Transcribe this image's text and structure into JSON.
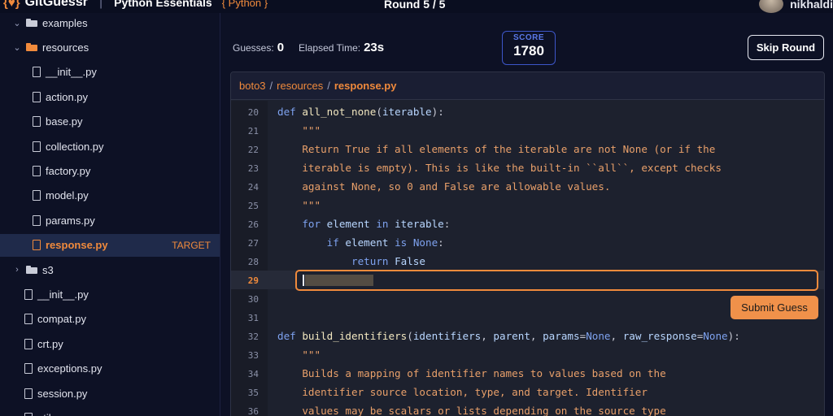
{
  "header": {
    "app_name": "GitGuessr",
    "repo": "Python Essentials",
    "language": "{ Python }",
    "round": "Round 5 / 5",
    "username": "nikhaldi"
  },
  "stats": {
    "guesses_label": "Guesses:",
    "guesses": "0",
    "elapsed_label": "Elapsed Time:",
    "elapsed": "23s",
    "score_label": "SCORE",
    "score": "1780",
    "skip_label": "Skip Round"
  },
  "sidebar": {
    "items": [
      {
        "label": "examples",
        "kind": "folder",
        "color": "gray",
        "chevron": "v"
      },
      {
        "label": "resources",
        "kind": "folder",
        "color": "orange",
        "chevron": "v"
      },
      {
        "label": "__init__.py",
        "kind": "file"
      },
      {
        "label": "action.py",
        "kind": "file"
      },
      {
        "label": "base.py",
        "kind": "file"
      },
      {
        "label": "collection.py",
        "kind": "file"
      },
      {
        "label": "factory.py",
        "kind": "file"
      },
      {
        "label": "model.py",
        "kind": "file"
      },
      {
        "label": "params.py",
        "kind": "file"
      },
      {
        "label": "response.py",
        "kind": "file",
        "active": true,
        "tag": "TARGET"
      },
      {
        "label": "s3",
        "kind": "folder",
        "color": "gray",
        "chevron": ">"
      },
      {
        "label": "__init__.py",
        "kind": "file"
      },
      {
        "label": "compat.py",
        "kind": "file"
      },
      {
        "label": "crt.py",
        "kind": "file"
      },
      {
        "label": "exceptions.py",
        "kind": "file"
      },
      {
        "label": "session.py",
        "kind": "file"
      },
      {
        "label": "utils.py",
        "kind": "file"
      }
    ]
  },
  "breadcrumb": [
    "boto3",
    "resources",
    "response.py"
  ],
  "code": {
    "current_line": 29,
    "lines": [
      {
        "n": "20",
        "tokens": [
          [
            "kw",
            "def "
          ],
          [
            "fn",
            "all_not_none"
          ],
          [
            "op",
            "("
          ],
          [
            "id",
            "iterable"
          ],
          [
            "op",
            "):"
          ]
        ]
      },
      {
        "n": "21",
        "tokens": [
          [
            "str",
            "    \"\"\""
          ]
        ]
      },
      {
        "n": "22",
        "tokens": [
          [
            "str",
            "    Return True if all elements of the iterable are not None (or if the"
          ]
        ]
      },
      {
        "n": "23",
        "tokens": [
          [
            "str",
            "    iterable is empty). This is like the built-in ``all``, except checks"
          ]
        ]
      },
      {
        "n": "24",
        "tokens": [
          [
            "str",
            "    against None, so 0 and False are allowable values."
          ]
        ]
      },
      {
        "n": "25",
        "tokens": [
          [
            "str",
            "    \"\"\""
          ]
        ]
      },
      {
        "n": "26",
        "tokens": [
          [
            "kw",
            "    for "
          ],
          [
            "id",
            "element "
          ],
          [
            "kw",
            "in "
          ],
          [
            "id",
            "iterable"
          ],
          [
            "op",
            ":"
          ]
        ]
      },
      {
        "n": "27",
        "tokens": [
          [
            "kw",
            "        if "
          ],
          [
            "id",
            "element "
          ],
          [
            "kw",
            "is "
          ],
          [
            "kw",
            "None"
          ],
          [
            "op",
            ":"
          ]
        ]
      },
      {
        "n": "28",
        "tokens": [
          [
            "kw",
            "            return "
          ],
          [
            "id",
            "False"
          ]
        ]
      },
      {
        "n": "29",
        "tokens": []
      },
      {
        "n": "30",
        "tokens": []
      },
      {
        "n": "31",
        "tokens": []
      },
      {
        "n": "32",
        "tokens": [
          [
            "kw",
            "def "
          ],
          [
            "fn",
            "build_identifiers"
          ],
          [
            "op",
            "("
          ],
          [
            "id",
            "identifiers"
          ],
          [
            "op",
            ", "
          ],
          [
            "id",
            "parent"
          ],
          [
            "op",
            ", "
          ],
          [
            "id",
            "params"
          ],
          [
            "op",
            "="
          ],
          [
            "kw",
            "None"
          ],
          [
            "op",
            ", "
          ],
          [
            "id",
            "raw_response"
          ],
          [
            "op",
            "="
          ],
          [
            "kw",
            "None"
          ],
          [
            "op",
            "):"
          ]
        ]
      },
      {
        "n": "33",
        "tokens": [
          [
            "str",
            "    \"\"\""
          ]
        ]
      },
      {
        "n": "34",
        "tokens": [
          [
            "str",
            "    Builds a mapping of identifier names to values based on the"
          ]
        ]
      },
      {
        "n": "35",
        "tokens": [
          [
            "str",
            "    identifier source location, type, and target. Identifier"
          ]
        ]
      },
      {
        "n": "36",
        "tokens": [
          [
            "str",
            "    values may be scalars or lists depending on the source type"
          ]
        ]
      }
    ]
  },
  "guess": {
    "submit_label": "Submit Guess"
  }
}
